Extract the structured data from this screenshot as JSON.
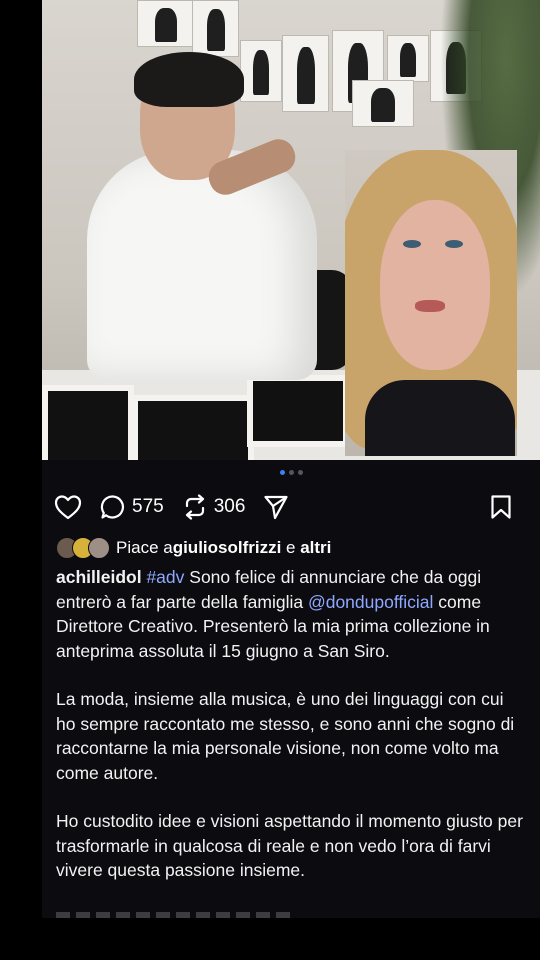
{
  "post": {
    "carousel": {
      "total": 3,
      "active": 0
    },
    "actions": {
      "comments": "575",
      "reposts": "306"
    },
    "likes": {
      "prefix": "Piace a ",
      "user": "giuliosolfrizzi",
      "middle": " e ",
      "others": "altri"
    },
    "caption": {
      "username": "achilleidol",
      "hashtag": "#adv",
      "p1_a": " Sono felice di annunciare che da oggi entrerò a far parte della famiglia ",
      "mention": "@dondupofficial",
      "p1_b": " come Direttore Creativo. Presenterò la mia prima collezione in anteprima assoluta il 15 giugno a San Siro.",
      "p2": "La moda, insieme alla musica, è uno dei linguaggi con cui ho sempre raccontato me stesso, e sono anni che sogno di raccontarne la mia personale visione, non come volto ma come autore.",
      "p3": "Ho custodito idee e visioni aspettando il momento giusto per trasformarle in qualcosa di reale e non vedo l’ora di farvi vivere questa passione insieme."
    }
  },
  "colors": {
    "background": "#0b0b10",
    "mention": "#8fa8ff",
    "active_dot": "#3b82f6"
  },
  "icons": [
    "heart-icon",
    "comment-icon",
    "repost-icon",
    "share-icon",
    "bookmark-icon"
  ]
}
